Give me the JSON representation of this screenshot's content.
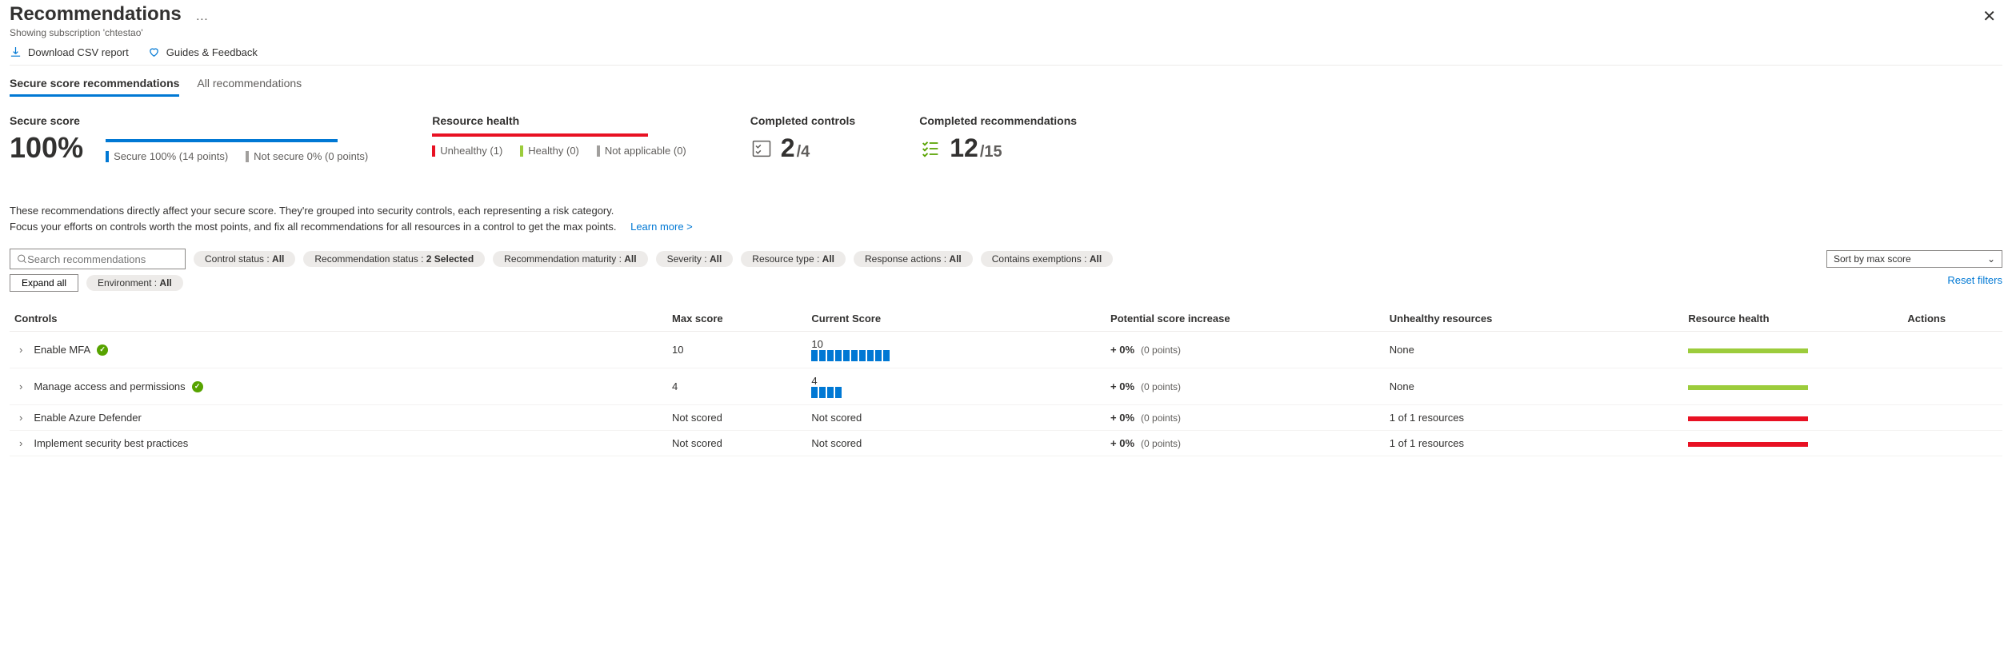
{
  "header": {
    "title": "Recommendations",
    "subtitle": "Showing subscription 'chtestao'"
  },
  "toolbar": {
    "download": "Download CSV report",
    "feedback": "Guides & Feedback"
  },
  "tabs": {
    "secure": "Secure score recommendations",
    "all": "All recommendations"
  },
  "stats": {
    "secure_score": {
      "label": "Secure score",
      "value": "100%",
      "legend1": "Secure 100% (14 points)",
      "legend2": "Not secure 0% (0 points)"
    },
    "resource_health": {
      "label": "Resource health",
      "unhealthy": "Unhealthy (1)",
      "healthy": "Healthy (0)",
      "na": "Not applicable (0)"
    },
    "completed_controls": {
      "label": "Completed controls",
      "num": "2",
      "denom": "/4"
    },
    "completed_recs": {
      "label": "Completed recommendations",
      "num": "12",
      "denom": "/15"
    }
  },
  "description": {
    "line1": "These recommendations directly affect your secure score. They're grouped into security controls, each representing a risk category.",
    "line2": "Focus your efforts on controls worth the most points, and fix all recommendations for all resources in a control to get the max points.",
    "learn": "Learn more >"
  },
  "filters": {
    "search_placeholder": "Search recommendations",
    "expand": "Expand all",
    "sort": "Sort by max score",
    "reset": "Reset filters",
    "pills": [
      {
        "label": "Control status : ",
        "value": "All"
      },
      {
        "label": "Recommendation status : ",
        "value": "2 Selected"
      },
      {
        "label": "Recommendation maturity : ",
        "value": "All"
      },
      {
        "label": "Severity : ",
        "value": "All"
      },
      {
        "label": "Resource type : ",
        "value": "All"
      },
      {
        "label": "Response actions : ",
        "value": "All"
      },
      {
        "label": "Contains exemptions : ",
        "value": "All"
      }
    ],
    "env_pill": {
      "label": "Environment : ",
      "value": "All"
    }
  },
  "table": {
    "headers": {
      "controls": "Controls",
      "max": "Max score",
      "current": "Current Score",
      "pot": "Potential score increase",
      "unhealthy": "Unhealthy resources",
      "health": "Resource health",
      "actions": "Actions"
    },
    "rows": [
      {
        "name": "Enable MFA",
        "check": true,
        "max": "10",
        "curr": "10",
        "bars": 10,
        "inc": "+ 0%",
        "pts": "(0 points)",
        "res": "None",
        "healthColor": "#9ccc3c"
      },
      {
        "name": "Manage access and permissions",
        "check": true,
        "max": "4",
        "curr": "4",
        "bars": 4,
        "inc": "+ 0%",
        "pts": "(0 points)",
        "res": "None",
        "healthColor": "#9ccc3c"
      },
      {
        "name": "Enable Azure Defender",
        "check": false,
        "max": "Not scored",
        "curr": "Not scored",
        "bars": 0,
        "inc": "+ 0%",
        "pts": "(0 points)",
        "res": "1 of 1 resources",
        "healthColor": "#e81123"
      },
      {
        "name": "Implement security best practices",
        "check": false,
        "max": "Not scored",
        "curr": "Not scored",
        "bars": 0,
        "inc": "+ 0%",
        "pts": "(0 points)",
        "res": "1 of 1 resources",
        "healthColor": "#e81123"
      }
    ]
  }
}
